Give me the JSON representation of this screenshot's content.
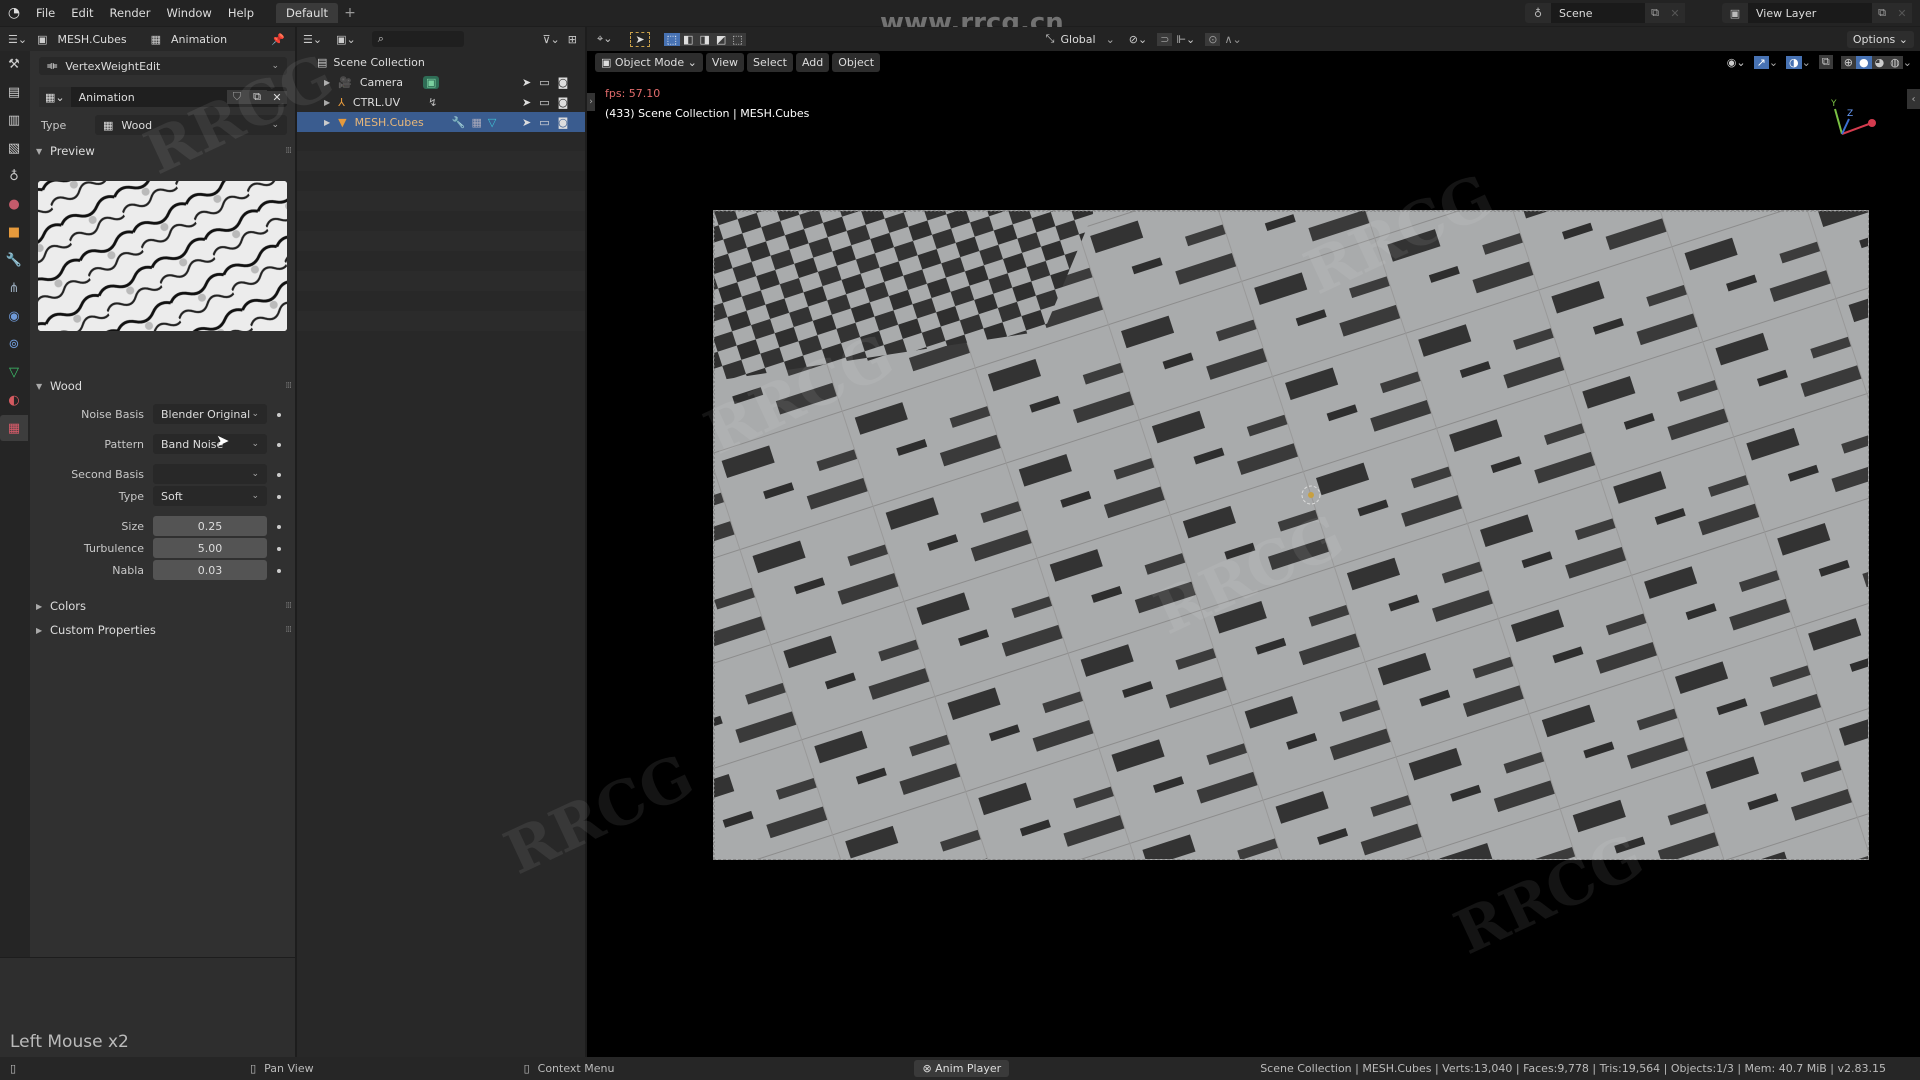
{
  "menubar": {
    "items": [
      "File",
      "Edit",
      "Render",
      "Window",
      "Help"
    ],
    "workspace_tab": "Default",
    "add_tab": "+",
    "scene": "Scene",
    "view_layer": "View Layer",
    "watermark_url": "www.rrcg.cn"
  },
  "properties": {
    "breadcrumb_object": "MESH.Cubes",
    "breadcrumb_texture": "Animation",
    "modifier_selector": "VertexWeightEdit",
    "texture_name": "Animation",
    "type_label": "Type",
    "type_value": "Wood",
    "preview_panel": "Preview",
    "wood_panel": "Wood",
    "fields": [
      {
        "label": "Noise Basis",
        "value": "Blender Original",
        "kind": "dropdown"
      },
      {
        "label": "Pattern",
        "value": "Band Noise",
        "kind": "dropdown"
      },
      {
        "label": "Second Basis",
        "value": "",
        "kind": "dropdown"
      },
      {
        "label": "Type",
        "value": "Soft",
        "kind": "dropdown"
      },
      {
        "label": "Size",
        "value": "0.25",
        "kind": "number"
      },
      {
        "label": "Turbulence",
        "value": "5.00",
        "kind": "number"
      },
      {
        "label": "Nabla",
        "value": "0.03",
        "kind": "number"
      }
    ],
    "colors_panel": "Colors",
    "custom_props_panel": "Custom Properties",
    "last_operator": "Left Mouse x2"
  },
  "outliner": {
    "root": "Scene Collection",
    "items": [
      {
        "name": "Camera",
        "selected": false
      },
      {
        "name": "CTRL.UV",
        "selected": false
      },
      {
        "name": "MESH.Cubes",
        "selected": true
      }
    ]
  },
  "viewport": {
    "mode": "Object Mode",
    "menus": [
      "View",
      "Select",
      "Add",
      "Object"
    ],
    "fps": "fps: 57.10",
    "info": "(433) Scene Collection | MESH.Cubes",
    "orientation": "Global",
    "options": "Options",
    "gizmo_axes": [
      "Y",
      "Z",
      "X"
    ],
    "accent": "#4772b3"
  },
  "statusbar": {
    "pan_view": "Pan View",
    "context_menu": "Context Menu",
    "anim_player": "Anim Player",
    "stats": "Scene Collection | MESH.Cubes | Verts:13,040 | Faces:9,778 | Tris:19,564 | Objects:1/3 | Mem: 40.7 MiB | v2.83.15"
  }
}
